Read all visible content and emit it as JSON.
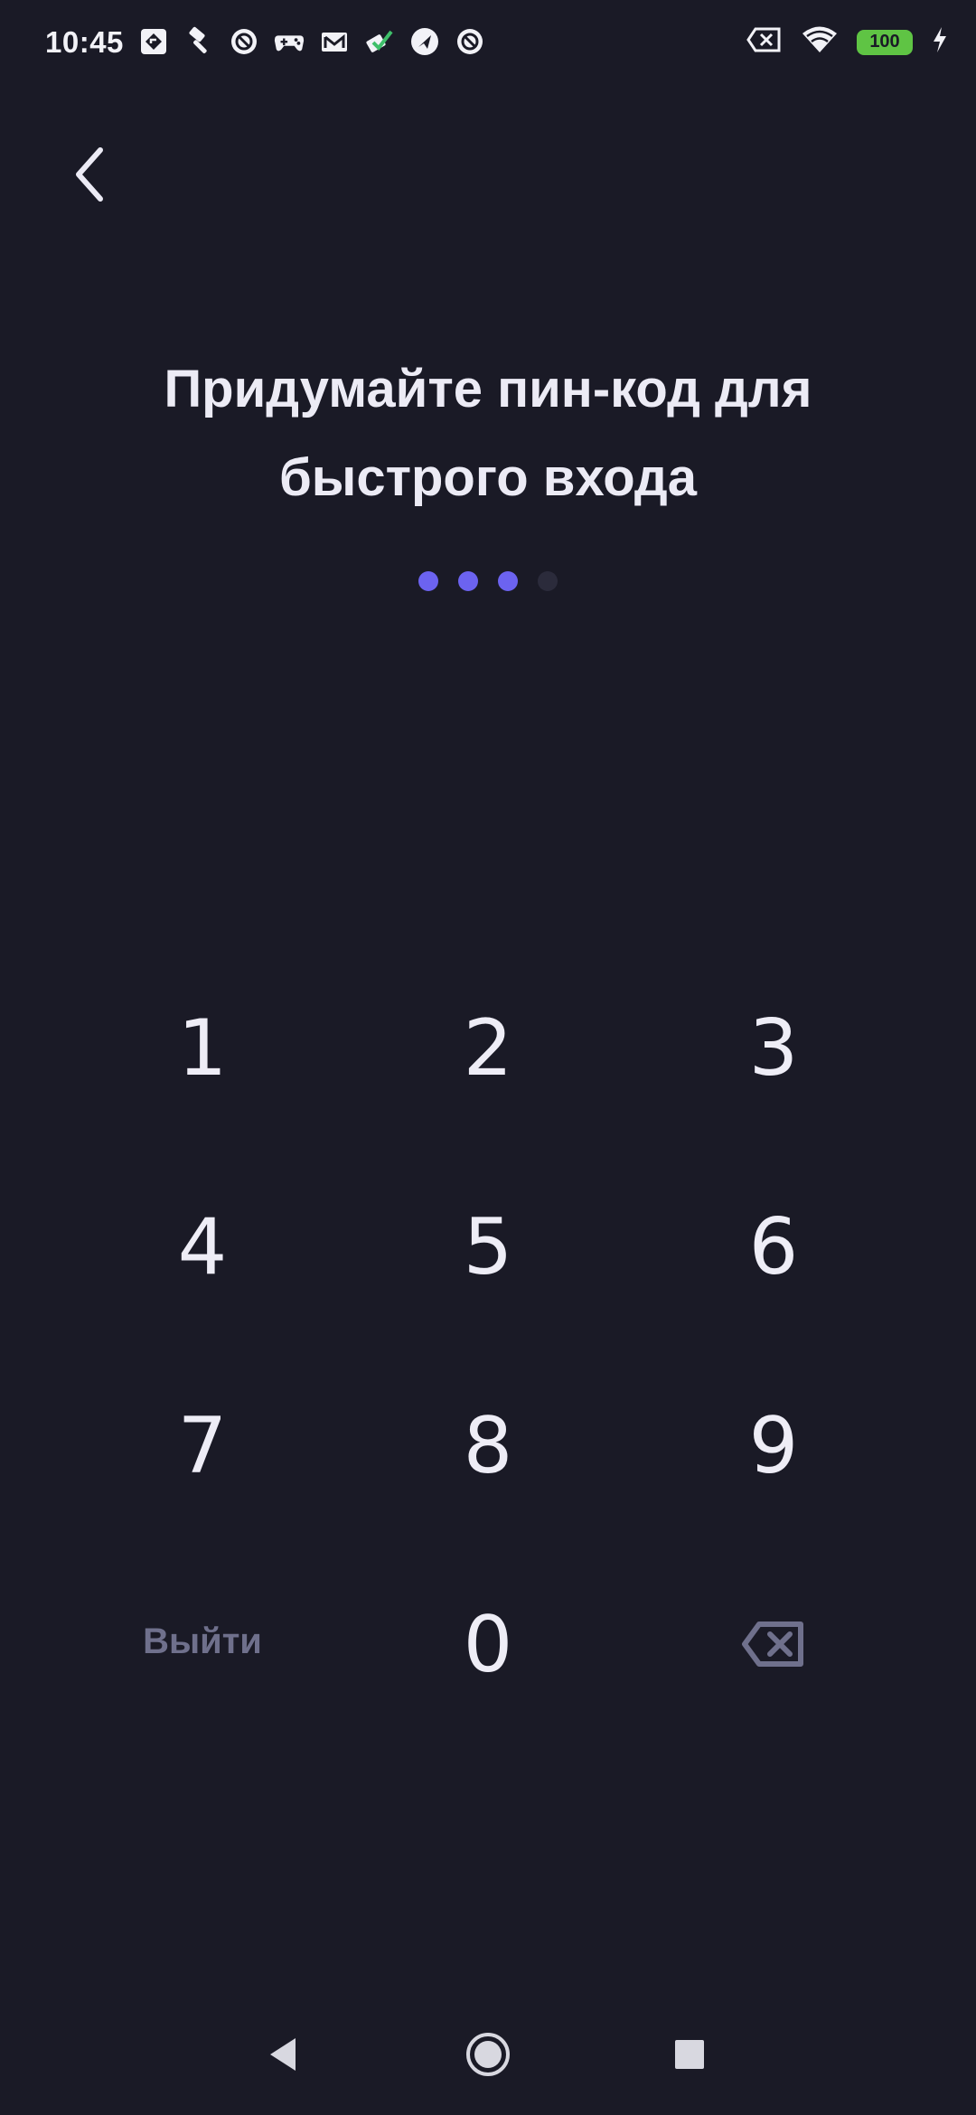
{
  "status_bar": {
    "time": "10:45",
    "battery_level": "100",
    "notification_icons": [
      "maps-icon",
      "hammer-icon",
      "app-icon",
      "gamepad-icon",
      "mail-icon",
      "check-icon",
      "nav-icon",
      "app-icon"
    ],
    "system_icons": [
      "sim-x-icon",
      "wifi-icon",
      "battery-icon",
      "charging-icon"
    ],
    "battery_color": "#5fc444"
  },
  "header": {
    "back_icon": "chevron-left-icon"
  },
  "title": {
    "line1": "Придумайте пин-код для",
    "line2": "быстрого входа"
  },
  "pin": {
    "length": 4,
    "filled": 3,
    "filled_color": "#6c63f0",
    "empty_color": "#2b2b3b"
  },
  "keypad": {
    "keys": [
      "1",
      "2",
      "3",
      "4",
      "5",
      "6",
      "7",
      "8",
      "9"
    ],
    "zero": "0",
    "exit_label": "Выйти",
    "backspace_icon": "backspace-icon"
  },
  "nav_bar": {
    "icons": [
      "back-triangle-icon",
      "home-circle-icon",
      "recents-square-icon"
    ]
  },
  "colors": {
    "background": "#1a1a26",
    "text": "#ecebf5",
    "muted": "#6f708c"
  }
}
